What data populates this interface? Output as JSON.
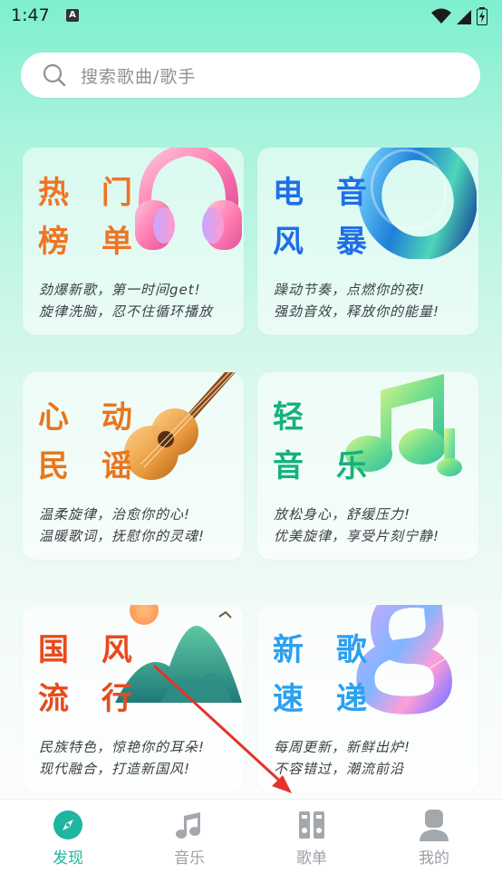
{
  "status_bar": {
    "time": "1:47",
    "notification_icon": "A"
  },
  "search": {
    "placeholder": "搜索歌曲/歌手"
  },
  "cards": [
    {
      "title_line1": "热 门",
      "title_line2": "榜 单",
      "desc_line1": "劲爆新歌，第一时间get!",
      "desc_line2": "旋律洗脑，忍不住循环播放",
      "icon": "headphones-icon",
      "color": "#f07424"
    },
    {
      "title_line1": "电 音",
      "title_line2": "风 暴",
      "desc_line1": "躁动节奏，点燃你的夜!",
      "desc_line2": "强劲音效，释放你的能量!",
      "icon": "ring-icon",
      "color": "#1e6fe6"
    },
    {
      "title_line1": "心 动",
      "title_line2": "民 谣",
      "desc_line1": "温柔旋律，治愈你的心!",
      "desc_line2": "温暖歌词，抚慰你的灵魂!",
      "icon": "guitar-icon",
      "color": "#e8761c"
    },
    {
      "title_line1": "轻",
      "title_line2": "音 乐",
      "desc_line1": "放松身心，舒缓压力!",
      "desc_line2": "优美旋律，享受片刻宁静!",
      "icon": "music-note-icon",
      "color": "#16b27a"
    },
    {
      "title_line1": "国 风",
      "title_line2": "流 行",
      "desc_line1": "民族特色，惊艳你的耳朵!",
      "desc_line2": "现代融合，打造新国风!",
      "icon": "mountain-icon",
      "color": "#e84a1e"
    },
    {
      "title_line1": "新 歌",
      "title_line2": "速 递",
      "desc_line1": "每周更新，新鲜出炉!",
      "desc_line2": "不容错过，潮流前沿",
      "icon": "infinity-icon",
      "color": "#2aa0f0"
    }
  ],
  "tabs": [
    {
      "label": "发现",
      "icon": "compass-icon",
      "active": true
    },
    {
      "label": "音乐",
      "icon": "music-icon",
      "active": false
    },
    {
      "label": "歌单",
      "icon": "playlist-icon",
      "active": false
    },
    {
      "label": "我的",
      "icon": "user-icon",
      "active": false
    }
  ],
  "colors": {
    "accent": "#1fb5a0",
    "tab_inactive": "#9aa0a6",
    "annotation_arrow": "#e5322b"
  }
}
